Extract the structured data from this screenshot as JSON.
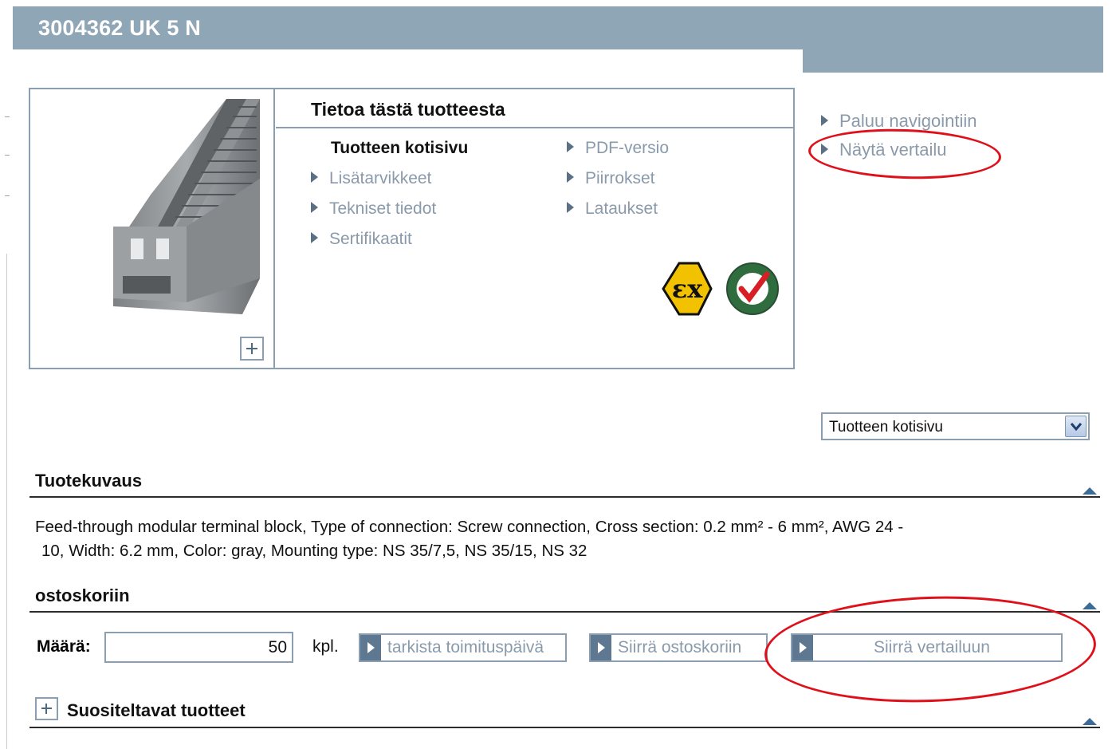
{
  "header": {
    "title": "3004362 UK 5 N"
  },
  "info_panel": {
    "heading": "Tietoa tästä tuotteesta",
    "current_page": "Tuotteen kotisivu",
    "links_left": [
      "Lisätarvikkeet",
      "Tekniset tiedot",
      "Sertifikaatit"
    ],
    "links_right": [
      "PDF-versio",
      "Piirrokset",
      "Lataukset"
    ]
  },
  "side_links": {
    "back": "Paluu navigointiin",
    "compare": "Näytä vertailu"
  },
  "page_select": {
    "selected": "Tuotteen kotisivu"
  },
  "description": {
    "title": "Tuotekuvaus",
    "line1": "Feed-through modular terminal block, Type of connection: Screw connection, Cross section: 0.2 mm² - 6 mm², AWG 24 -",
    "line2": "10, Width: 6.2 mm, Color: gray, Mounting type: NS 35/7,5, NS 35/15, NS 32"
  },
  "cart": {
    "title": "ostoskoriin",
    "quantity_label": "Määrä:",
    "quantity_value": "50",
    "unit": "kpl.",
    "check_delivery_label": "tarkista toimituspäivä",
    "add_to_cart_label": "Siirrä ostoskoriin",
    "add_to_compare_label": "Siirrä vertailuun"
  },
  "recommended": {
    "title": "Suositeltavat tuotteet"
  },
  "colors": {
    "header_bar": "#8fa6b7",
    "link_grey": "#8a9aab",
    "border_blue": "#8aa0b2",
    "annotation_red": "#e0101a"
  },
  "icons": [
    "zoom-plus-icon",
    "ex-certification-icon",
    "weee-rohs-compliant-icon",
    "dropdown-arrow-icon",
    "collapse-arrow-icon",
    "expand-plus-icon"
  ]
}
